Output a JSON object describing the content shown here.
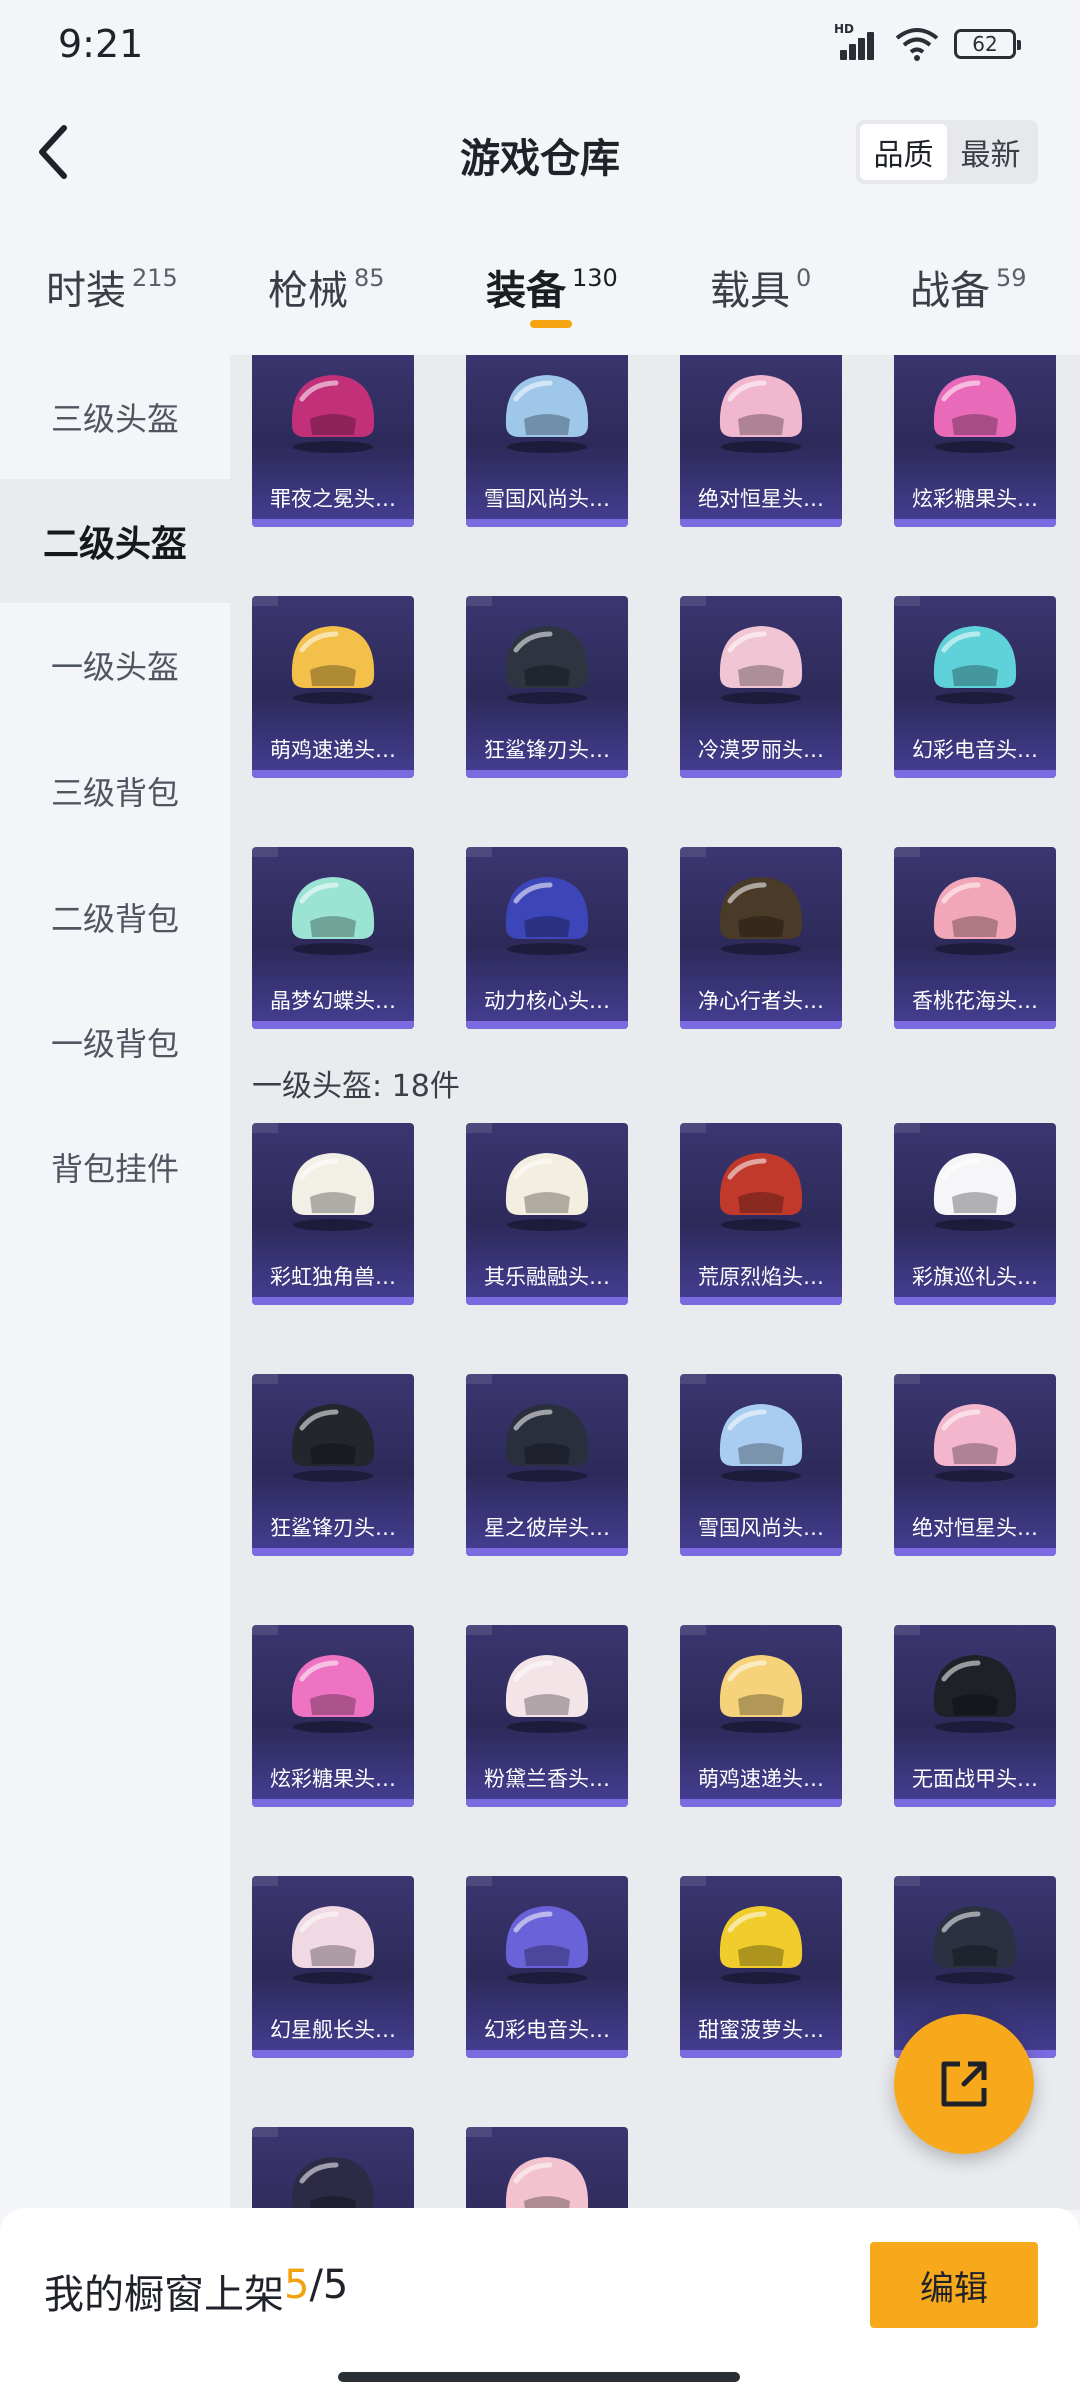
{
  "status_bar": {
    "time": "9:21",
    "hd": "HD",
    "battery": "62"
  },
  "header": {
    "title": "游戏仓库",
    "sort_options": [
      "品质",
      "最新"
    ],
    "active_sort": "品质"
  },
  "category_tabs": [
    {
      "label": "时装",
      "count": "215"
    },
    {
      "label": "枪械",
      "count": "85"
    },
    {
      "label": "装备",
      "count": "130"
    },
    {
      "label": "载具",
      "count": "0"
    },
    {
      "label": "战备",
      "count": "59"
    }
  ],
  "active_tab": "装备",
  "sidebar": {
    "items": [
      "三级头盔",
      "二级头盔",
      "一级头盔",
      "三级背包",
      "二级背包",
      "一级背包",
      "背包挂件"
    ],
    "active": "二级头盔"
  },
  "group_two": {
    "items": [
      {
        "name": "罪夜之冕头…",
        "color": "#c2307a"
      },
      {
        "name": "雪国风尚头…",
        "color": "#9fc7ea"
      },
      {
        "name": "绝对恒星头…",
        "color": "#f1b7cf"
      },
      {
        "name": "炫彩糖果头…",
        "color": "#e86ab8"
      },
      {
        "name": "萌鸡速递头…",
        "color": "#f3c04a"
      },
      {
        "name": "狂鲨锋刃头…",
        "color": "#2e3440"
      },
      {
        "name": "冷漠罗丽头…",
        "color": "#f1c6d4"
      },
      {
        "name": "幻彩电音头…",
        "color": "#5fd1d8"
      },
      {
        "name": "晶梦幻蝶头…",
        "color": "#9be3d2"
      },
      {
        "name": "动力核心头…",
        "color": "#3c46b8"
      },
      {
        "name": "净心行者头…",
        "color": "#4a3a28"
      },
      {
        "name": "香桃花海头…",
        "color": "#f2a7b8"
      }
    ]
  },
  "group_one": {
    "label": "一级头盔: 18件",
    "items": [
      {
        "name": "彩虹独角兽…",
        "color": "#f2efe6"
      },
      {
        "name": "其乐融融头…",
        "color": "#f4eee0"
      },
      {
        "name": "荒原烈焰头…",
        "color": "#c0392b"
      },
      {
        "name": "彩旗巡礼头…",
        "color": "#f6f6f8"
      },
      {
        "name": "狂鲨锋刃头…",
        "color": "#23262d"
      },
      {
        "name": "星之彼岸头…",
        "color": "#2a2f3d"
      },
      {
        "name": "雪国风尚头…",
        "color": "#a9cdf0"
      },
      {
        "name": "绝对恒星头…",
        "color": "#f3b6cc"
      },
      {
        "name": "炫彩糖果头…",
        "color": "#ef73c3"
      },
      {
        "name": "粉黛兰香头…",
        "color": "#f3e4e8"
      },
      {
        "name": "萌鸡速递头…",
        "color": "#f6d37a"
      },
      {
        "name": "无面战甲头…",
        "color": "#1e2128"
      },
      {
        "name": "幻星舰长头…",
        "color": "#f0d9e3"
      },
      {
        "name": "幻彩电音头…",
        "color": "#6a62d8"
      },
      {
        "name": "甜蜜菠萝头…",
        "color": "#f0cd2c"
      },
      {
        "name": "",
        "color": "#2b3140"
      },
      {
        "name": "",
        "color": "#2d2a45"
      },
      {
        "name": "",
        "color": "#f2c2cf"
      }
    ]
  },
  "bottom_bar": {
    "label": "我的橱窗上架",
    "count": "5",
    "total": "/5",
    "edit_label": "编辑"
  }
}
